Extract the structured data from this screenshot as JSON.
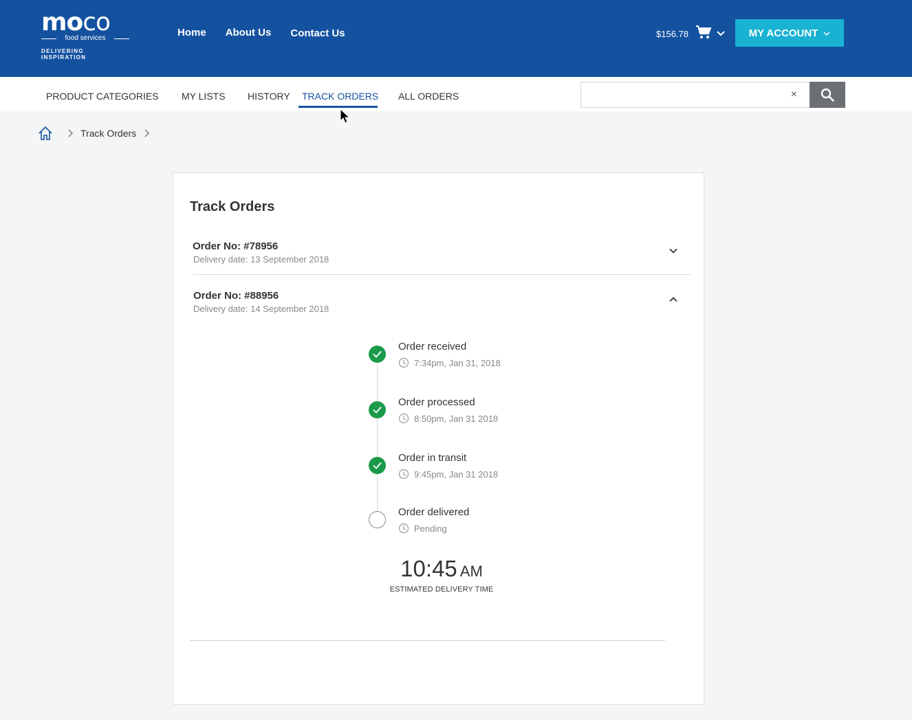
{
  "brand": {
    "logo_word": "moco",
    "logo_sub": "food services",
    "tagline": "DELIVERING INSPIRATION"
  },
  "main_nav": [
    "Home",
    "About Us",
    "Contact Us"
  ],
  "cart": {
    "amount": "$156.78"
  },
  "account": {
    "label": "MY ACCOUNT"
  },
  "sub_nav": {
    "items": [
      "PRODUCT CATEGORIES",
      "MY LISTS",
      "HISTORY",
      "TRACK ORDERS",
      "ALL ORDERS"
    ],
    "active": "TRACK ORDERS"
  },
  "search": {
    "value": "",
    "placeholder": "",
    "clear_label": "×"
  },
  "breadcrumb": {
    "current": "Track Orders"
  },
  "page": {
    "title": "Track Orders",
    "orders": [
      {
        "number": "Order No: #78956",
        "delivery": "Delivery date: 13 September 2018",
        "expanded": false
      },
      {
        "number": "Order No: #88956",
        "delivery": "Delivery date: 14 September 2018",
        "expanded": true
      }
    ],
    "tracking_steps": [
      {
        "label": "Order received",
        "time": "7:34pm, Jan 31, 2018",
        "status": "done"
      },
      {
        "label": "Order processed",
        "time": "8:50pm, Jan 31 2018",
        "status": "done"
      },
      {
        "label": "Order in transit",
        "time": "9:45pm, Jan 31 2018",
        "status": "done"
      },
      {
        "label": "Order delivered",
        "time": "Pending",
        "status": "pending"
      }
    ],
    "eta": {
      "time": "10:45",
      "ampm": "AM",
      "caption": "ESTIMATED DELIVERY TIME"
    }
  },
  "colors": {
    "header_bg": "#1452a0",
    "account_btn": "#1ab2d3",
    "search_btn": "#6c7075",
    "step_done": "#1a9a4a"
  }
}
